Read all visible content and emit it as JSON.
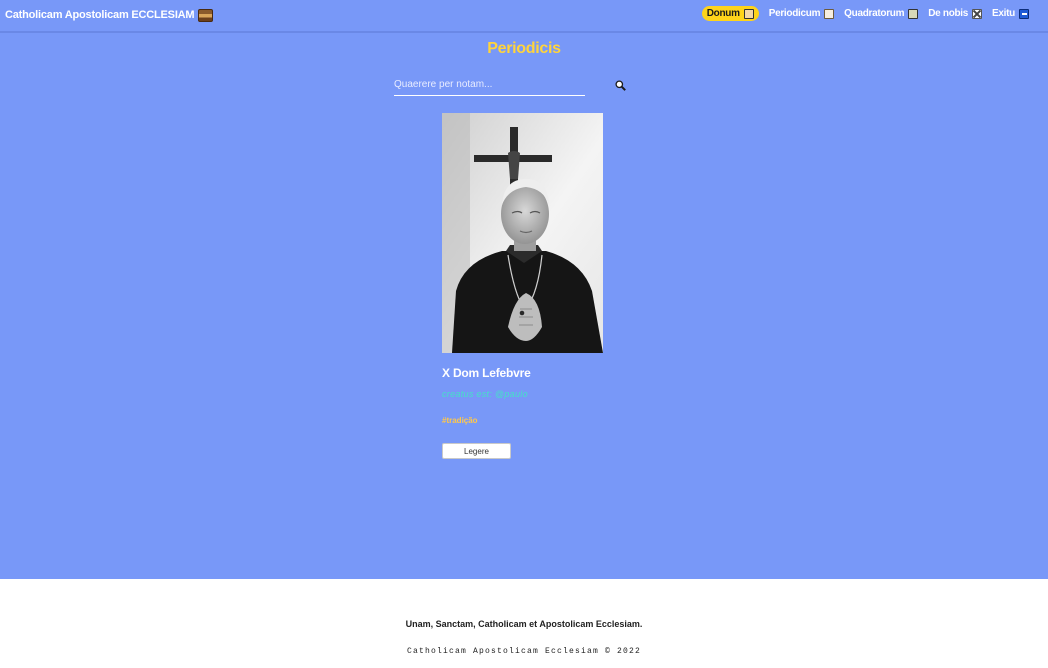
{
  "header": {
    "brand": "Catholicam Apostolicam ECCLESIAM",
    "brand_icon": "church-icon",
    "nav": [
      {
        "label": "Donum",
        "icon": "hand-pointing-icon",
        "highlight": "#ffd41a"
      },
      {
        "label": "Periodicum",
        "icon": "book-icon"
      },
      {
        "label": "Quadratorum",
        "icon": "picture-frame-icon"
      },
      {
        "label": "De nobis",
        "icon": "crossed-swords-icon"
      },
      {
        "label": "Exitu",
        "icon": "exit-icon"
      }
    ]
  },
  "main": {
    "title": "Periodicis",
    "search": {
      "placeholder": "Quaerere per notam...",
      "value": ""
    },
    "post": {
      "title": "X Dom Lefebvre",
      "meta": "creatus est: @paulo",
      "tag": "#tradição",
      "read_label": "Legere"
    }
  },
  "footer": {
    "motto": "Unam, Sanctam, Catholicam et Apostolicam Ecclesiam.",
    "copyright": "Catholicam Apostolicam Ecclesiam © 2022"
  },
  "colors": {
    "background": "#7898f8",
    "accent": "#ffd43b",
    "meta": "#46e0c8",
    "tag": "#ffc84a"
  }
}
